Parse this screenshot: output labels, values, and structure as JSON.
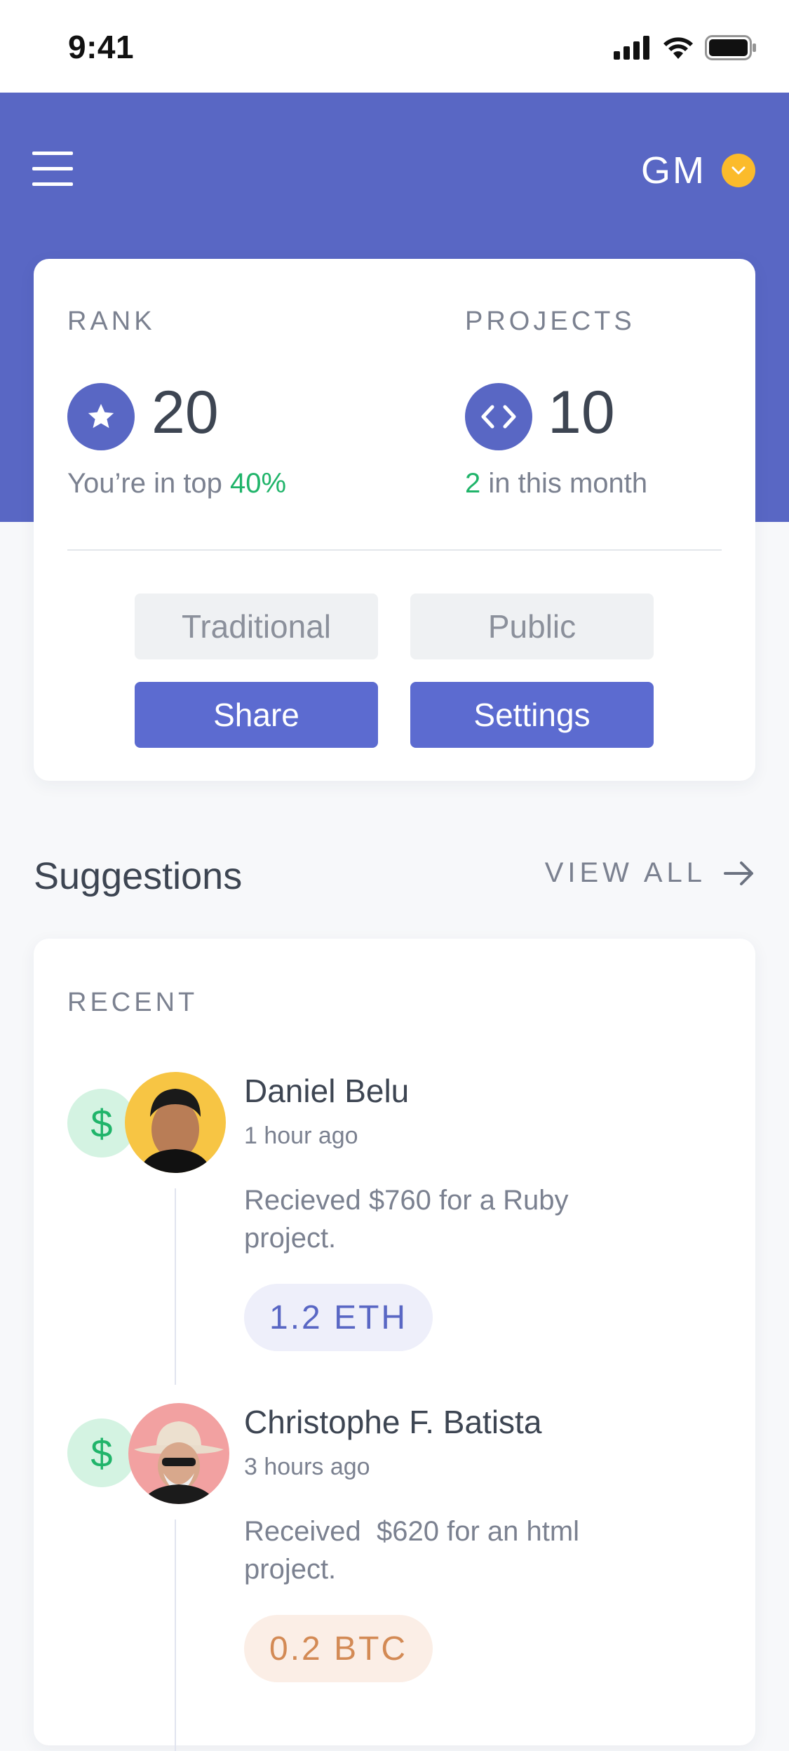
{
  "status_bar": {
    "time": "9:41"
  },
  "header": {
    "user_initials": "GM"
  },
  "stats": {
    "rank": {
      "label": "RANK",
      "value": "20",
      "sub_prefix": "You’re in top ",
      "sub_highlight": "40%"
    },
    "projects": {
      "label": "PROJECTS",
      "value": "10",
      "sub_highlight": "2",
      "sub_suffix": " in this month"
    }
  },
  "buttons": {
    "traditional": "Traditional",
    "public": "Public",
    "share": "Share",
    "settings": "Settings"
  },
  "suggestions": {
    "title": "Suggestions",
    "view_all": "VIEW ALL",
    "recent_label": "RECENT",
    "items": [
      {
        "icon": "dollar-icon",
        "name": "Daniel Belu",
        "time": "1 hour ago",
        "description": "Recieved $760 for a Ruby project.",
        "amount": "1.2 ETH"
      },
      {
        "icon": "dollar-icon",
        "name": "Christophe F. Batista",
        "time": "3 hours ago",
        "description": "Received  $620 for an html project.",
        "amount": "0.2 BTC"
      }
    ]
  },
  "colors": {
    "brand": "#5967c4",
    "button_primary": "#5c6bd0",
    "positive": "#20b46a",
    "accent_yellow": "#fbbb2b",
    "eth_pill": "#eeeffa",
    "btc_pill": "#fbeee6"
  }
}
